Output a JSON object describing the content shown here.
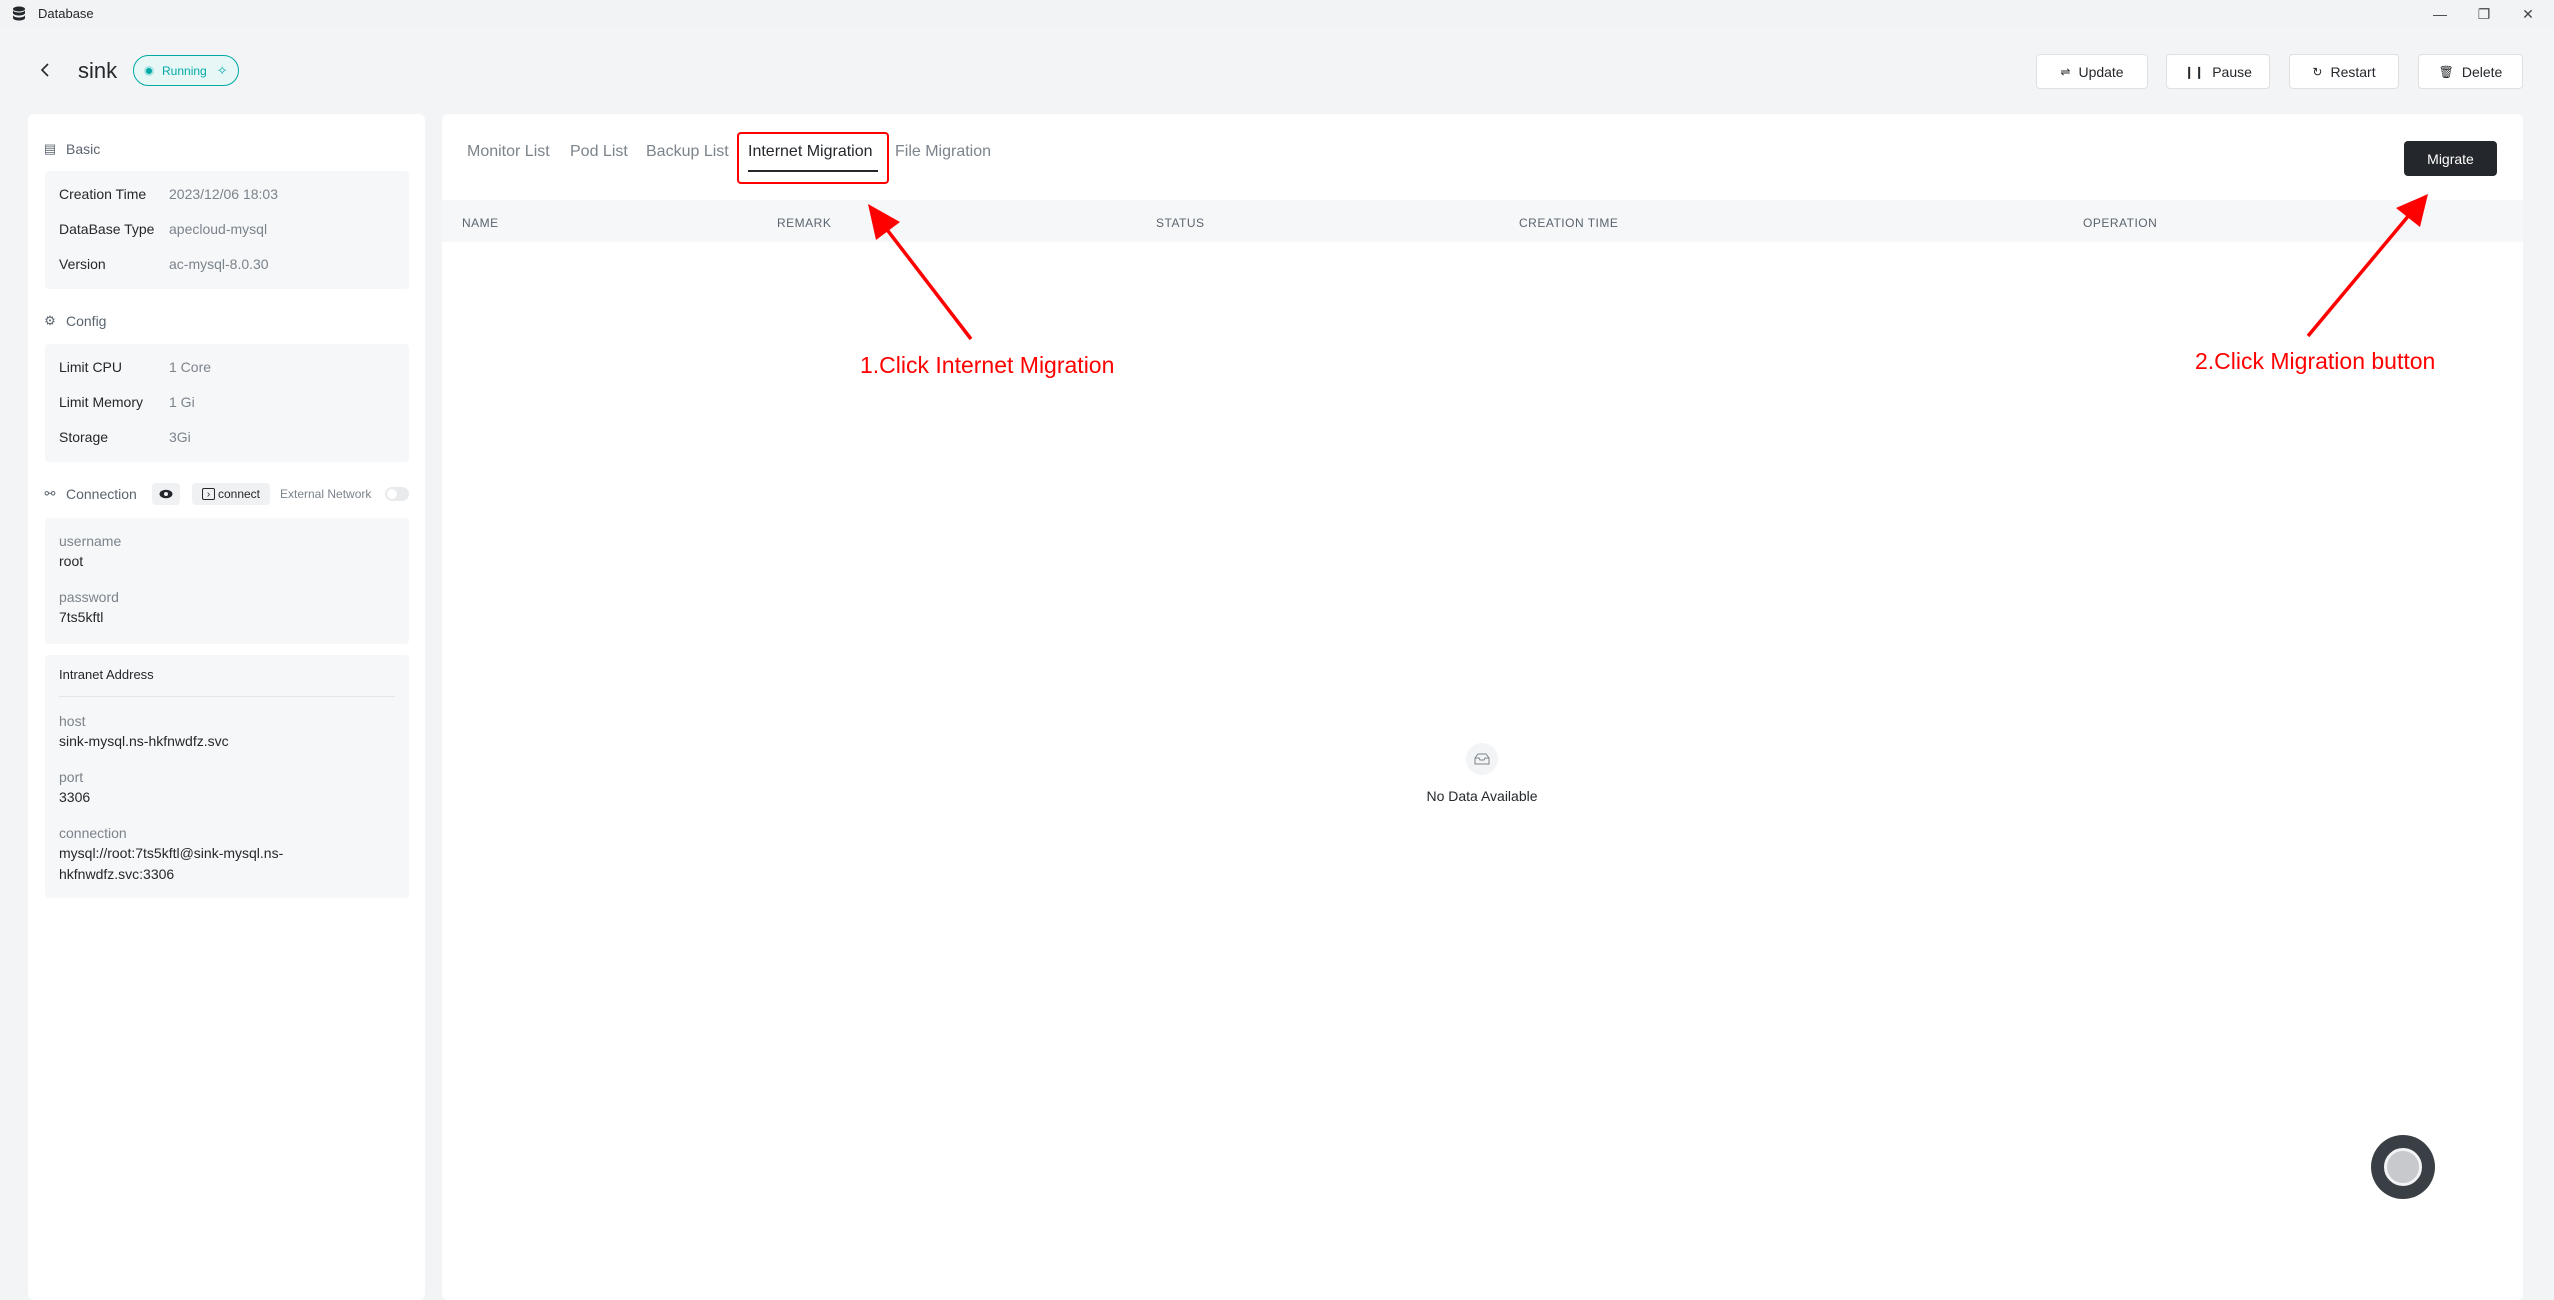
{
  "window": {
    "title": "Database",
    "app_icon": "database-icon"
  },
  "header": {
    "db_name": "sink",
    "status": "Running",
    "actions": [
      {
        "label": "Update",
        "icon": "update-icon"
      },
      {
        "label": "Pause",
        "icon": "pause-icon"
      },
      {
        "label": "Restart",
        "icon": "restart-icon"
      },
      {
        "label": "Delete",
        "icon": "delete-icon"
      }
    ]
  },
  "basic": {
    "title": "Basic",
    "rows": [
      {
        "key": "Creation Time",
        "value": "2023/12/06 18:03"
      },
      {
        "key": "DataBase Type",
        "value": "apecloud-mysql"
      },
      {
        "key": "Version",
        "value": "ac-mysql-8.0.30"
      }
    ]
  },
  "config": {
    "title": "Config",
    "rows": [
      {
        "key": "Limit CPU",
        "value": "1 Core"
      },
      {
        "key": "Limit Memory",
        "value": "1 Gi"
      },
      {
        "key": "Storage",
        "value": "3Gi"
      }
    ]
  },
  "connection": {
    "title": "Connection",
    "connect_label": "connect",
    "external_network_label": "External Network",
    "external_network_enabled": false,
    "username_label": "username",
    "username": "root",
    "password_label": "password",
    "password": "7ts5kftl",
    "intranet_title": "Intranet Address",
    "host_label": "host",
    "host": "sink-mysql.ns-hkfnwdfz.svc",
    "port_label": "port",
    "port": "3306",
    "connection_label": "connection",
    "connection_line1": "mysql://root:7ts5kftl@sink-mysql.ns-",
    "connection_line2": "hkfnwdfz.svc:3306"
  },
  "tabs": [
    {
      "label": "Monitor List",
      "active": false
    },
    {
      "label": "Pod List",
      "active": false
    },
    {
      "label": "Backup List",
      "active": false
    },
    {
      "label": "Internet Migration",
      "active": true
    },
    {
      "label": "File Migration",
      "active": false
    }
  ],
  "migrate_button": "Migrate",
  "table": {
    "columns": [
      "NAME",
      "REMARK",
      "STATUS",
      "CREATION TIME",
      "OPERATION"
    ],
    "empty_text": "No Data Available"
  },
  "annotations": {
    "step1": "1.Click Internet Migration",
    "step2": "2.Click Migration button",
    "color": "#ff0000"
  }
}
